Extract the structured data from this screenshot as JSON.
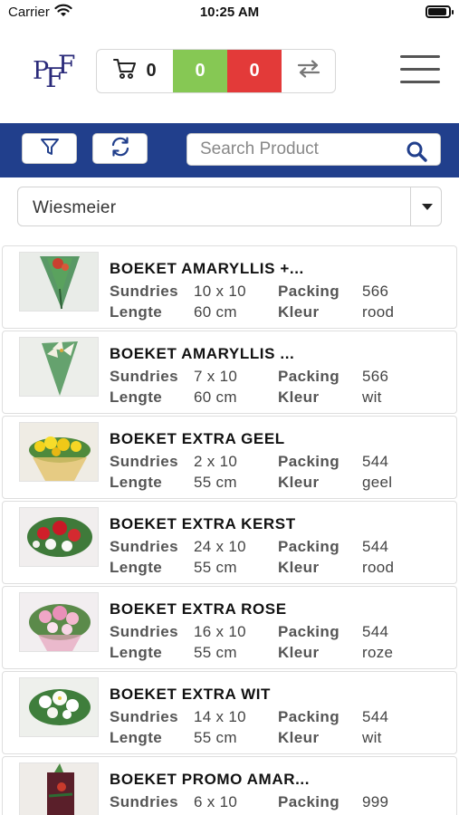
{
  "status_bar": {
    "carrier": "Carrier",
    "time": "10:25 AM"
  },
  "header": {
    "logo_letters": [
      "P",
      "F",
      "F"
    ],
    "cart_count": "0",
    "green_count": "0",
    "red_count": "0"
  },
  "toolbar": {
    "search_placeholder": "Search Product",
    "colors": {
      "bar": "#213f8c",
      "green": "#86c854",
      "red": "#e33a39"
    }
  },
  "filter_select": {
    "selected": "Wiesmeier"
  },
  "labels": {
    "sundries": "Sundries",
    "packing": "Packing",
    "lengte": "Lengte",
    "kleur": "Kleur"
  },
  "products": [
    {
      "name": "BOEKET AMARYLLIS +...",
      "sundries": "10 x 10",
      "packing": "566",
      "lengte": "60 cm",
      "kleur": "rood"
    },
    {
      "name": "BOEKET AMARYLLIS ...",
      "sundries": "7 x 10",
      "packing": "566",
      "lengte": "60 cm",
      "kleur": "wit"
    },
    {
      "name": "BOEKET EXTRA GEEL",
      "sundries": "2 x 10",
      "packing": "544",
      "lengte": "55 cm",
      "kleur": "geel"
    },
    {
      "name": "BOEKET EXTRA KERST",
      "sundries": "24 x 10",
      "packing": "544",
      "lengte": "55 cm",
      "kleur": "rood"
    },
    {
      "name": "BOEKET EXTRA ROSE",
      "sundries": "16 x 10",
      "packing": "544",
      "lengte": "55 cm",
      "kleur": "roze"
    },
    {
      "name": "BOEKET EXTRA WIT",
      "sundries": "14 x 10",
      "packing": "544",
      "lengte": "55 cm",
      "kleur": "wit"
    },
    {
      "name": "BOEKET PROMO AMAR...",
      "sundries": "6 x 10",
      "packing": "999",
      "lengte": "",
      "kleur": ""
    }
  ]
}
